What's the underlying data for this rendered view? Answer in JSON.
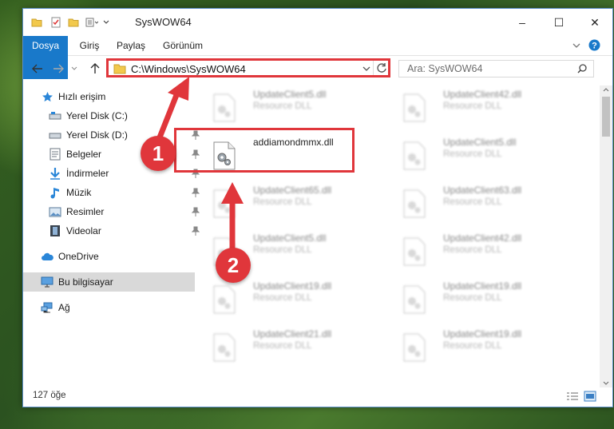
{
  "window": {
    "title": "SysWOW64",
    "controls": {
      "minimize": "–",
      "maximize": "☐",
      "close": "✕"
    }
  },
  "ribbon": {
    "tabs": [
      "Dosya",
      "Giriş",
      "Paylaş",
      "Görünüm"
    ]
  },
  "address": {
    "path": "C:\\Windows\\SysWOW64",
    "search_placeholder": "Ara: SysWOW64"
  },
  "sidebar": {
    "items": [
      {
        "label": "Hızlı erişim",
        "icon": "star-icon"
      },
      {
        "label": "Yerel Disk (C:)",
        "icon": "drive-icon"
      },
      {
        "label": "Yerel Disk (D:)",
        "icon": "drive-icon"
      },
      {
        "label": "Belgeler",
        "icon": "documents-icon"
      },
      {
        "label": "İndirmeler",
        "icon": "download-icon"
      },
      {
        "label": "Müzik",
        "icon": "music-icon"
      },
      {
        "label": "Resimler",
        "icon": "pictures-icon"
      },
      {
        "label": "Videolar",
        "icon": "video-icon"
      },
      {
        "label": "OneDrive",
        "icon": "cloud-icon"
      },
      {
        "label": "Bu bilgisayar",
        "icon": "computer-icon"
      },
      {
        "label": "Ağ",
        "icon": "network-icon"
      }
    ]
  },
  "files": {
    "type_label": "Resource DLL",
    "left_column": [
      "UpdateClient5.dll",
      "addiamondmmx.dll",
      "UpdateClient65.dll",
      "UpdateClient5.dll",
      "UpdateClient19.dll",
      "UpdateClient21.dll"
    ],
    "right_column": [
      "UpdateClient42.dll",
      "UpdateClient5.dll",
      "UpdateClient63.dll",
      "UpdateClient42.dll",
      "UpdateClient19.dll",
      "UpdateClient19.dll"
    ],
    "highlighted_name": "addiamondmmx.dll"
  },
  "status": {
    "count": "127 öğe"
  },
  "annotations": {
    "step1": "1",
    "step2": "2"
  },
  "colors": {
    "accent": "#1979ca",
    "annotation": "#e0363b"
  }
}
